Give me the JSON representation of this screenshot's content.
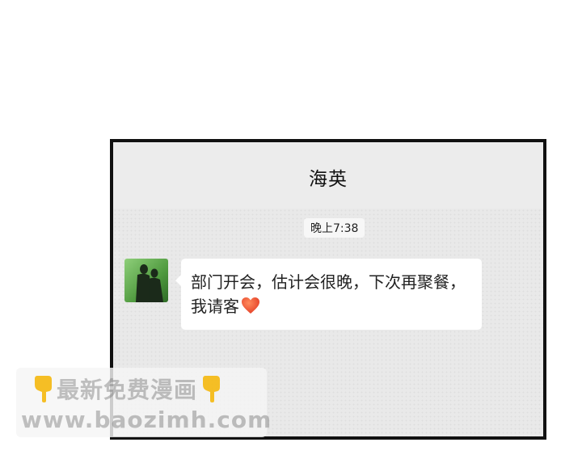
{
  "chat": {
    "title": "海英",
    "timestamp": "晚上7:38",
    "message": {
      "text": "部门开会，估计会很晚，下次再聚餐，我请客",
      "emoji": "heart-icon"
    },
    "avatar": "avatar-silhouette-image"
  },
  "watermark": {
    "line1": "最新免费漫画",
    "line2": "www.baozimh.com",
    "icon": "pointing-down-hand-icon"
  },
  "colors": {
    "header_bg": "#ececec",
    "chat_bg": "#e9e9e9",
    "bubble_bg": "#ffffff",
    "frame": "#111111",
    "heart": "#e8452c"
  }
}
